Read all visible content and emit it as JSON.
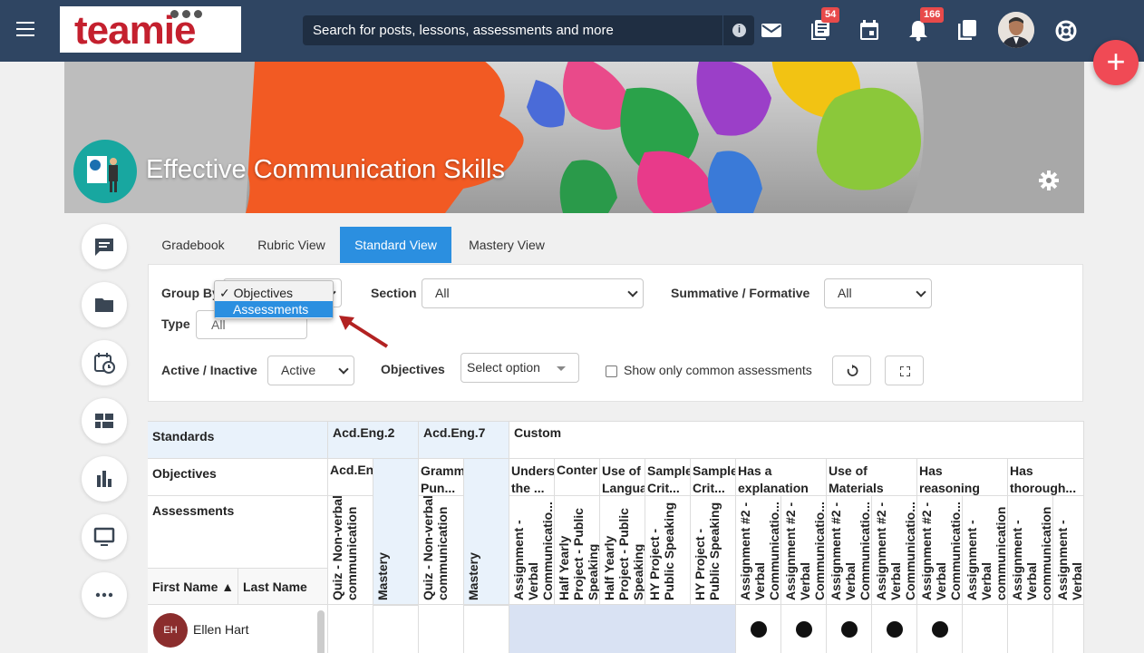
{
  "topbar": {
    "logo_text": "teamie",
    "search_placeholder": "Search for posts, lessons, assessments and more",
    "search_info": "i",
    "badges": {
      "lessons": "54",
      "notifications": "166"
    },
    "fab": "+"
  },
  "banner": {
    "course_title": "Effective Communication Skills"
  },
  "tabs": [
    {
      "label": "Gradebook"
    },
    {
      "label": "Rubric View"
    },
    {
      "label": "Standard View"
    },
    {
      "label": "Mastery View"
    }
  ],
  "filters": {
    "group_by_label": "Group By",
    "group_by_options": [
      "✓ Objectives",
      "Assessments"
    ],
    "section_label": "Section",
    "section_value": "All",
    "summative_label": "Summative / Formative",
    "summative_value": "All",
    "type_label": "Type",
    "type_value": "All",
    "active_label": "Active / Inactive",
    "active_value": "Active",
    "objectives_label": "Objectives",
    "objectives_placeholder": "Select option",
    "common_label": "Show only common assessments"
  },
  "table": {
    "row_labels": {
      "standards": "Standards",
      "objectives": "Objectives",
      "assessments": "Assessments"
    },
    "first_name": "First Name ▲",
    "last_name": "Last Name",
    "standards": [
      "Acd.Eng.2",
      "Acd.Eng.7",
      "Custom"
    ],
    "objectives": [
      "Acd.En",
      "Gramm Pun...",
      "Unders the ...",
      "Conter",
      "Use of Langua",
      "Sample Crit...",
      "Sample Crit...",
      "Has a explanation",
      "Use of Materials",
      "Has reasoning",
      "Has thorough..."
    ],
    "assessments": [
      "Quiz - Non-verbal communication",
      "Mastery",
      "Quiz - Non-verbal communication",
      "Mastery",
      "Assignment - Verbal Communicatio...",
      "Half Yearly Project - Public Speaking",
      "Half Yearly Project - Public Speaking",
      "HY Project - Public Speaking",
      "HY Project - Public Speaking",
      "Assignment #2 - Verbal Communicatio...",
      "Assignment #2 - Verbal Communicatio...",
      "Assignment #2 - Verbal Communicatio...",
      "Assignment #2 - Verbal Communicatio...",
      "Assignment #2 - Verbal Communicatio...",
      "Assignment - Verbal communication",
      "Assignment - Verbal communication",
      "Assignment - Verbal"
    ],
    "students": [
      {
        "initials": "EH",
        "name": "Ellen Hart"
      }
    ]
  }
}
